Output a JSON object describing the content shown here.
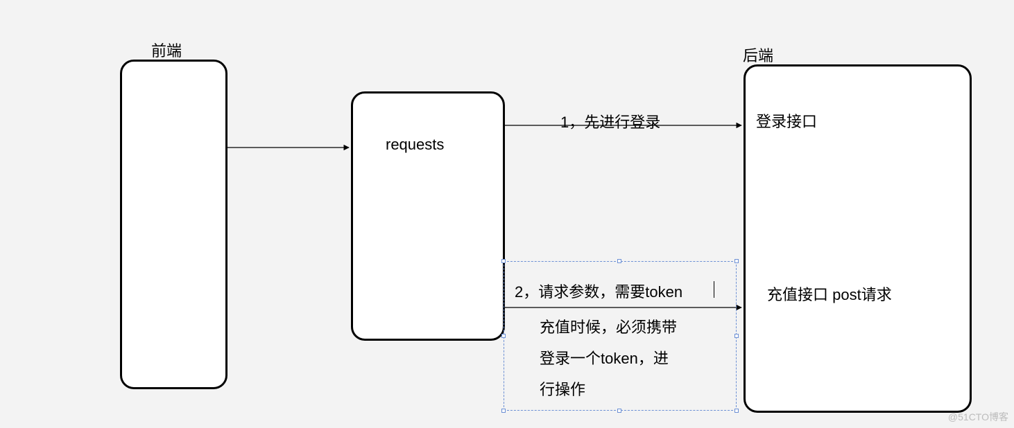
{
  "boxes": {
    "frontend": {
      "title": "前端"
    },
    "requests": {
      "label": "requests"
    },
    "backend": {
      "title": "后端",
      "login_label": "登录接口",
      "recharge_label": "充值接口 post请求"
    }
  },
  "arrows": {
    "a1": {
      "label": "1，先进行登录"
    },
    "a2": {
      "label": "2，请求参数，需要token",
      "note_l1": "充值时候，必须携带",
      "note_l2": "登录一个token，进",
      "note_l3": "行操作"
    }
  },
  "watermark": "@51CTO博客"
}
